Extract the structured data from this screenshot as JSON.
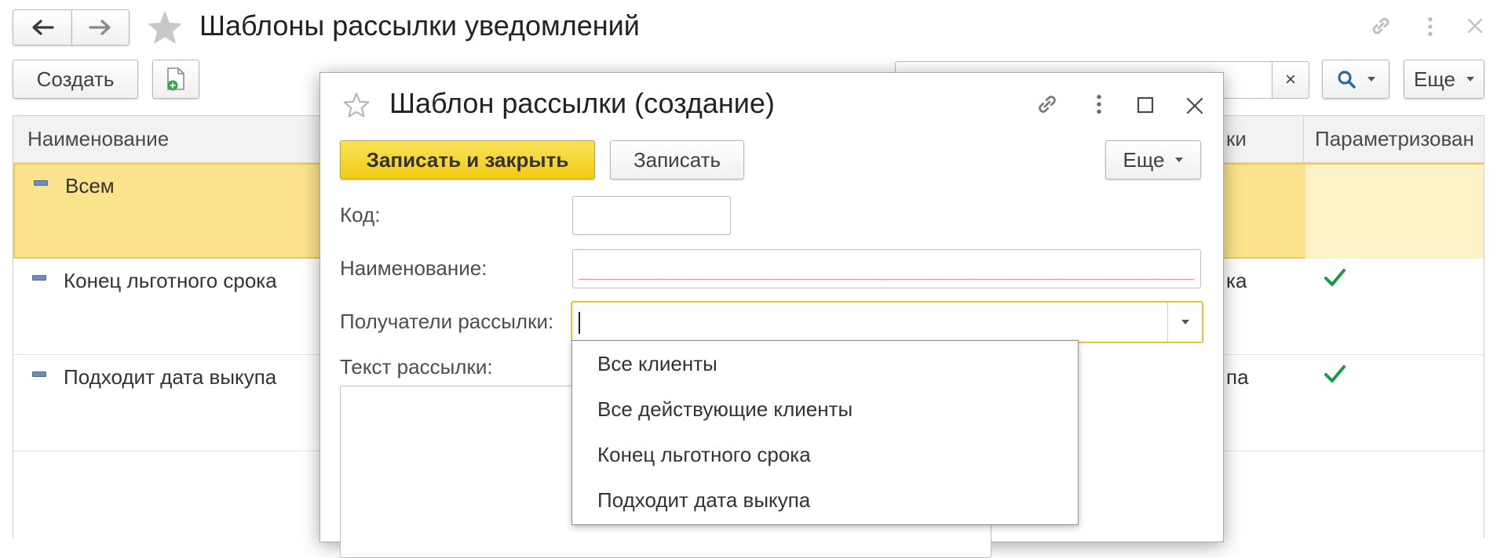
{
  "main": {
    "title": "Шаблоны рассылки уведомлений",
    "create_label": "Создать",
    "more_label": "Еще",
    "search_clear": "×"
  },
  "list": {
    "columns": [
      "Наименование",
      "ки",
      "Параметризован"
    ],
    "rows": [
      {
        "name": "Всем",
        "type_suffix": "",
        "parametrized": false,
        "selected": true
      },
      {
        "name": "Конец льготного срока",
        "type_suffix": "ка",
        "parametrized": true,
        "selected": false
      },
      {
        "name": "Подходит дата выкупа",
        "type_suffix": "па",
        "parametrized": true,
        "selected": false
      }
    ]
  },
  "dialog": {
    "title": "Шаблон рассылки (создание)",
    "save_close_label": "Записать и закрыть",
    "save_label": "Записать",
    "more_label": "Еще",
    "fields": {
      "code_label": "Код:",
      "code_value": "",
      "name_label": "Наименование:",
      "name_value": "",
      "recipients_label": "Получатели рассылки:",
      "recipients_value": "",
      "text_label": "Текст рассылки:"
    },
    "recipients_options": [
      "Все клиенты",
      "Все действующие клиенты",
      "Конец льготного срока",
      "Подходит дата выкупа"
    ]
  },
  "colors": {
    "accent_yellow": "#f7d321",
    "selected_row": "#fbe38e",
    "check_green": "#1a9a45",
    "focus_border": "#e8c237"
  }
}
